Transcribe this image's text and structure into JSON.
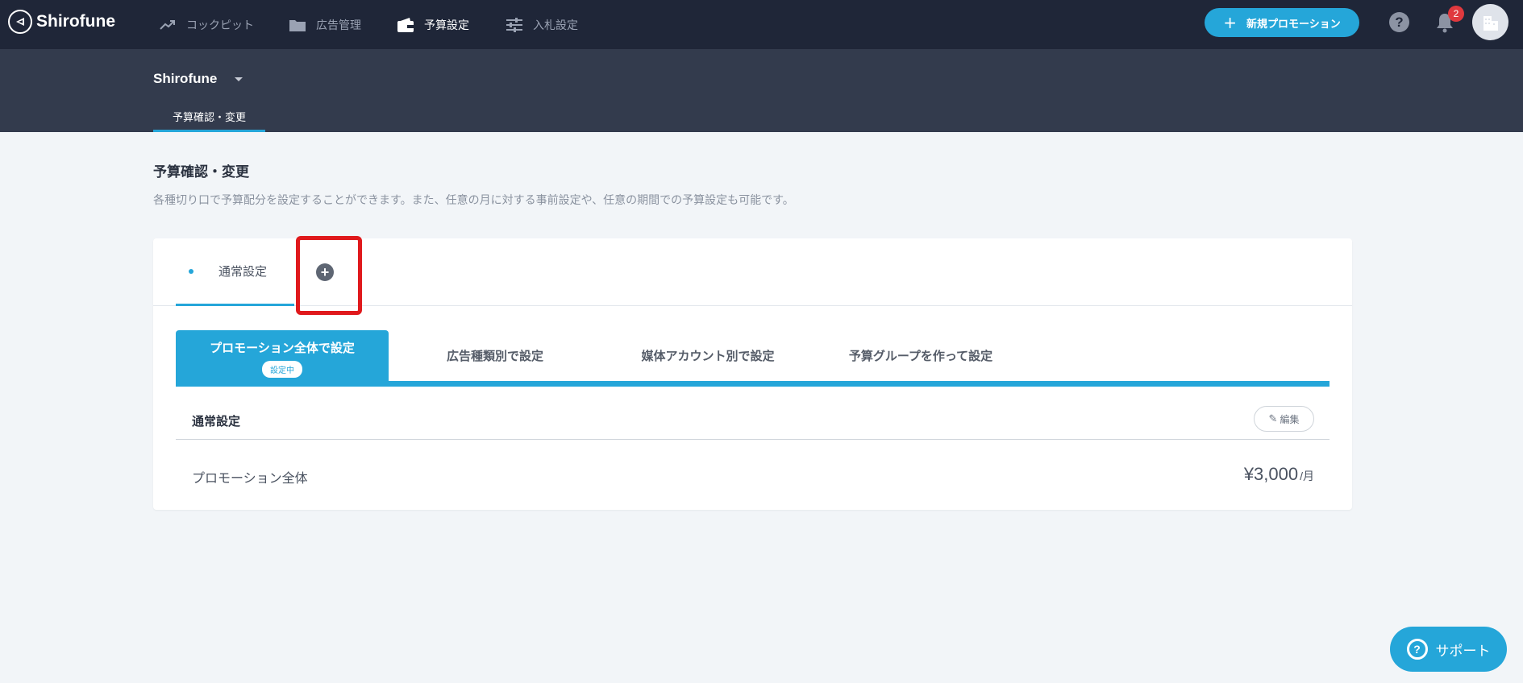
{
  "brand": {
    "name": "Shirofune"
  },
  "nav": {
    "items": [
      {
        "label": "コックピット",
        "icon": "trending-up-icon"
      },
      {
        "label": "広告管理",
        "icon": "folder-icon"
      },
      {
        "label": "予算設定",
        "icon": "wallet-icon",
        "active": true
      },
      {
        "label": "入札設定",
        "icon": "sliders-icon"
      }
    ],
    "new_promotion": "新規プロモーション",
    "help_icon": "question-circle-icon",
    "notification_count": "2"
  },
  "subheader": {
    "org_name": "Shirofune",
    "tab": "予算確認・変更"
  },
  "page": {
    "title": "予算確認・変更",
    "description": "各種切り口で予算配分を設定することができます。また、任意の月に対する事前設定や、任意の期間での予算設定も可能です。"
  },
  "card": {
    "tab_label": "通常設定",
    "add_symbol": "+",
    "subtabs": [
      {
        "label": "プロモーション全体で設定",
        "status": "設定中"
      },
      {
        "label": "広告種類別で設定"
      },
      {
        "label": "媒体アカウント別で設定"
      },
      {
        "label": "予算グループを作って設定"
      }
    ],
    "section_title": "通常設定",
    "edit_label": "編集",
    "row": {
      "label": "プロモーション全体",
      "amount": "¥3,000",
      "unit": "/月"
    }
  },
  "support": {
    "label": "サポート"
  },
  "colors": {
    "accent": "#25a6d9",
    "nav_bg": "#1f2638",
    "subheader_bg": "#333b4d",
    "highlight": "#e0191c"
  }
}
